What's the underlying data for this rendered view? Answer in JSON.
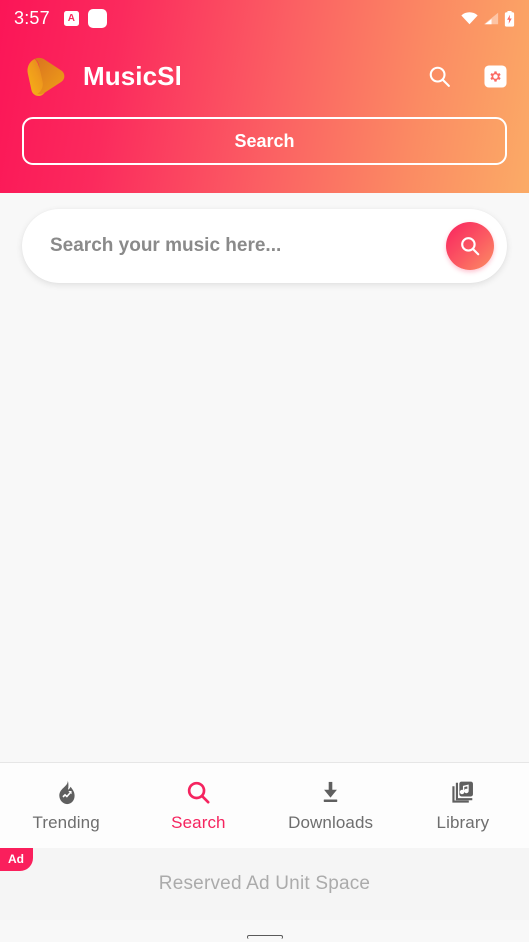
{
  "status_bar": {
    "time": "3:57",
    "left_icons": [
      {
        "name": "notification-badge-a-icon",
        "glyph": "A"
      },
      {
        "name": "notification-square-icon",
        "glyph": ""
      }
    ],
    "right_icons": [
      {
        "name": "wifi-icon"
      },
      {
        "name": "cellular-signal-icon"
      },
      {
        "name": "battery-charging-icon"
      }
    ]
  },
  "app_bar": {
    "brand_title": "MusicSl",
    "logo_icon": "play-swoosh-logo-icon",
    "actions": [
      {
        "name": "search-icon",
        "label": "Search"
      },
      {
        "name": "settings-gear-icon",
        "label": "Settings"
      }
    ]
  },
  "tabs": [
    {
      "label": "Search",
      "active": true
    }
  ],
  "search": {
    "placeholder": "Search your music here...",
    "value": "",
    "submit_icon": "search-icon"
  },
  "bottom_nav": {
    "items": [
      {
        "label": "Trending",
        "icon": "flame-trending-icon",
        "active": false
      },
      {
        "label": "Search",
        "icon": "search-icon",
        "active": true
      },
      {
        "label": "Downloads",
        "icon": "download-arrow-icon",
        "active": false
      },
      {
        "label": "Library",
        "icon": "library-music-icon",
        "active": false
      }
    ]
  },
  "ad": {
    "badge": "Ad",
    "placeholder_text": "Reserved Ad Unit Space"
  },
  "colors": {
    "gradient_start": "#fb1557",
    "gradient_end": "#fbab66",
    "accent_pink": "#f5245f",
    "nav_inactive": "#6e6e6e",
    "body_bg": "#f8f8f8",
    "ad_bg": "#f5f5f5"
  }
}
